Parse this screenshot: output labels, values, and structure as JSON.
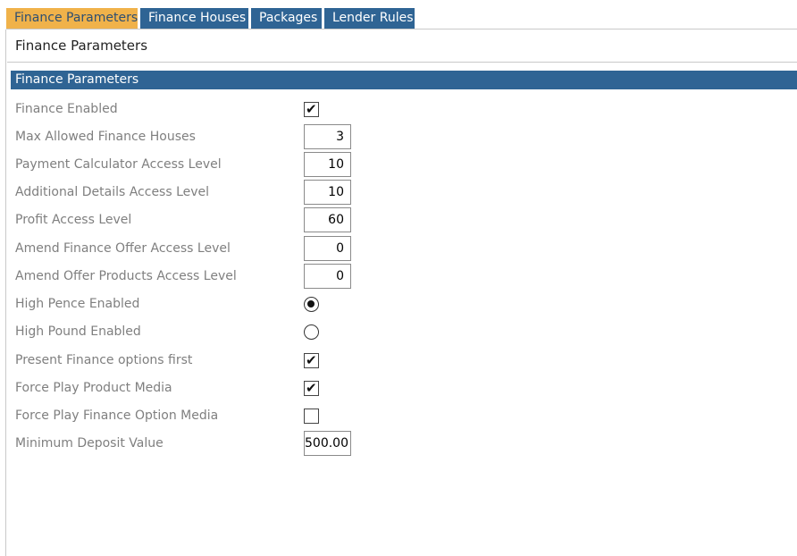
{
  "tabs": [
    {
      "label": "Finance Parameters",
      "active": true
    },
    {
      "label": "Finance Houses",
      "active": false
    },
    {
      "label": "Packages",
      "active": false
    },
    {
      "label": "Lender Rules",
      "active": false
    }
  ],
  "page": {
    "title": "Finance Parameters"
  },
  "section": {
    "title": "Finance Parameters"
  },
  "colors": {
    "tab_bg": "#2f6494",
    "tab_active_bg": "#f0b24a",
    "section_header_bg": "#2f6494"
  },
  "fields": {
    "finance_enabled": {
      "label": "Finance Enabled",
      "checked": true
    },
    "max_allowed_finance_houses": {
      "label": "Max Allowed Finance Houses",
      "value": "3"
    },
    "payment_calculator_access_level": {
      "label": "Payment Calculator Access Level",
      "value": "10"
    },
    "additional_details_access_level": {
      "label": "Additional Details Access Level",
      "value": "10"
    },
    "profit_access_level": {
      "label": "Profit Access Level",
      "value": "60"
    },
    "amend_finance_offer_access_level": {
      "label": "Amend Finance Offer Access Level",
      "value": "0"
    },
    "amend_offer_products_access_level": {
      "label": "Amend Offer Products Access Level",
      "value": "0"
    },
    "high_pence_enabled": {
      "label": "High Pence Enabled",
      "selected": true
    },
    "high_pound_enabled": {
      "label": "High Pound Enabled",
      "selected": false
    },
    "present_finance_options_first": {
      "label": "Present Finance options first",
      "checked": true
    },
    "force_play_product_media": {
      "label": "Force Play Product Media",
      "checked": true
    },
    "force_play_finance_option_media": {
      "label": "Force Play Finance Option Media",
      "checked": false
    },
    "minimum_deposit_value": {
      "label": "Minimum Deposit Value",
      "value": "500.00"
    }
  },
  "icons": {
    "check": "✔"
  }
}
